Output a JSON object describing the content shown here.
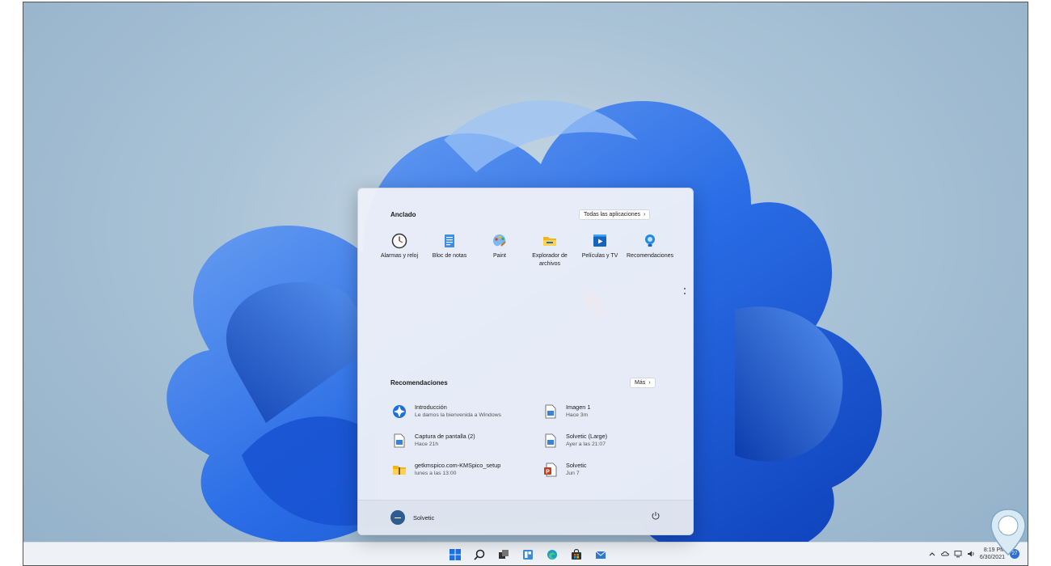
{
  "start_menu": {
    "pinned_title": "Anclado",
    "all_apps_label": "Todas las aplicaciones",
    "pinned_apps": [
      {
        "label": "Alarmas y reloj",
        "icon": "clock-icon"
      },
      {
        "label": "Bloc de notas",
        "icon": "notepad-icon"
      },
      {
        "label": "Paint",
        "icon": "paint-palette-icon"
      },
      {
        "label": "Explorador de archivos",
        "icon": "folder-icon"
      },
      {
        "label": "Películas y TV",
        "icon": "film-icon"
      },
      {
        "label": "Recomendaciones",
        "icon": "lightbulb-icon"
      }
    ],
    "recommended_title": "Recomendaciones",
    "more_label": "Más",
    "recommended": [
      {
        "title": "Introducción",
        "subtitle": "Le damos la bienvenida a Windows",
        "icon": "tips-icon"
      },
      {
        "title": "Imagen 1",
        "subtitle": "Hace 3m",
        "icon": "image-file-icon"
      },
      {
        "title": "Captura de pantalla (2)",
        "subtitle": "Hace 21h",
        "icon": "image-file-icon"
      },
      {
        "title": "Solvetic (Large)",
        "subtitle": "Ayer a las 21:07",
        "icon": "image-file-icon"
      },
      {
        "title": "getkmspico.com-KMSpico_setup",
        "subtitle": "lunes a las 13:00",
        "icon": "zip-folder-icon"
      },
      {
        "title": "Solvetic",
        "subtitle": "Jun 7",
        "icon": "powerpoint-file-icon"
      }
    ],
    "user_name": "Solvetic"
  },
  "taskbar": {
    "icons": [
      "windows-start-icon",
      "search-icon",
      "task-view-icon",
      "widgets-icon",
      "edge-icon",
      "store-icon",
      "mail-icon"
    ],
    "time": "8:19 PM",
    "date": "6/30/2021",
    "notification_count": "27"
  },
  "colors": {
    "accent": "#0f6cbd",
    "bloom_blue": "#1f63e0",
    "arrow_red": "#e0323a"
  }
}
